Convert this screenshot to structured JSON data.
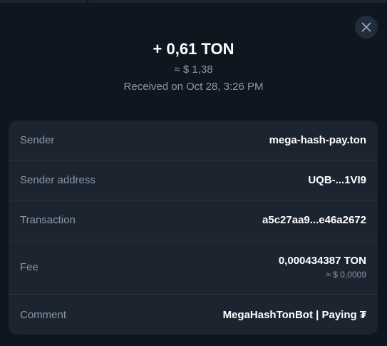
{
  "transaction": {
    "amount": "+ 0,61 TON",
    "usd_approx": "≈ $ 1,38",
    "received": "Received on Oct 28, 3:26 PM"
  },
  "details": {
    "sender_label": "Sender",
    "sender_value": "mega-hash-pay.ton",
    "sender_address_label": "Sender address",
    "sender_address_value": "UQB-...1VI9",
    "transaction_label": "Transaction",
    "transaction_value": "a5c27aa9...e46a2672",
    "fee_label": "Fee",
    "fee_value": "0,000434387 TON",
    "fee_usd": "≈ $ 0,0009",
    "comment_label": "Comment",
    "comment_value": "MegaHashTonBot | Paying ₮"
  },
  "icons": {
    "close": "close-icon"
  },
  "colors": {
    "background": "#10161f",
    "card": "#1c2430",
    "label": "#8b97a6",
    "value": "#ffffff"
  }
}
